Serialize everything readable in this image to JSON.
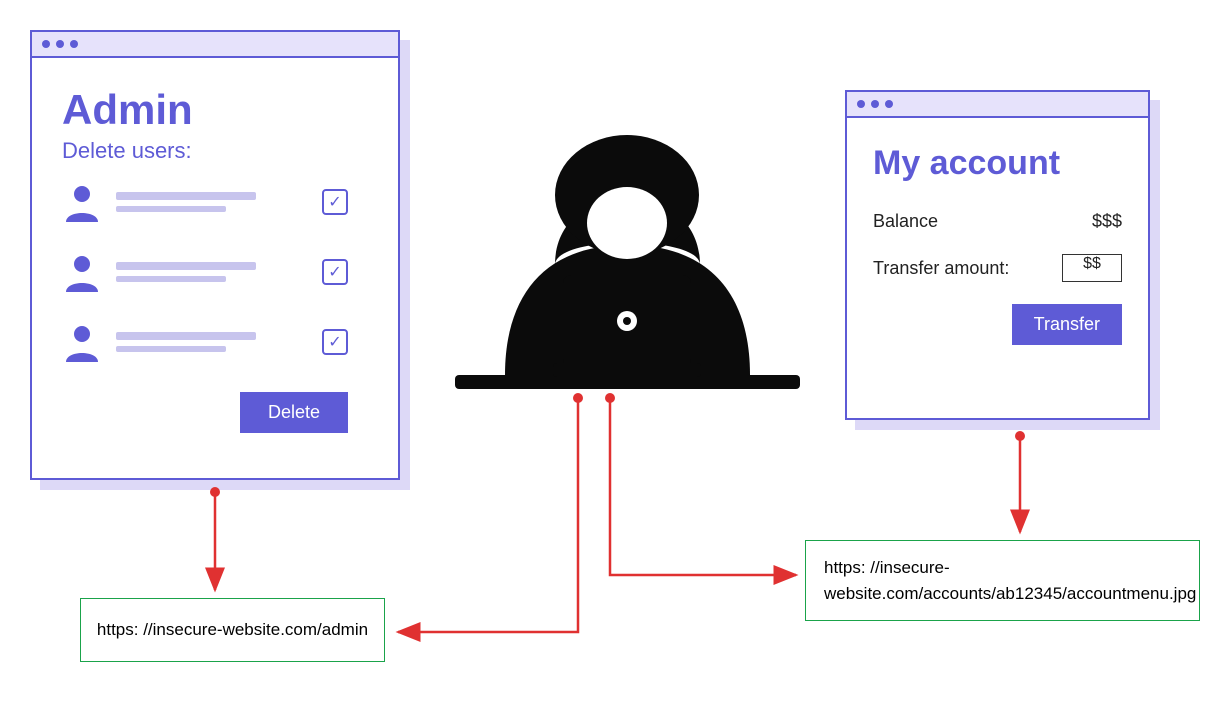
{
  "admin": {
    "title": "Admin",
    "subtitle": "Delete users:",
    "delete_label": "Delete"
  },
  "account": {
    "title": "My account",
    "balance_label": "Balance",
    "balance_value": "$$$",
    "transfer_label": "Transfer amount:",
    "transfer_value": "$$",
    "transfer_button": "Transfer"
  },
  "urls": {
    "admin_url": "https: //insecure-website.com/admin",
    "account_url": "https: //insecure-website.com/accounts/ab12345/accountmenu.jpg"
  }
}
